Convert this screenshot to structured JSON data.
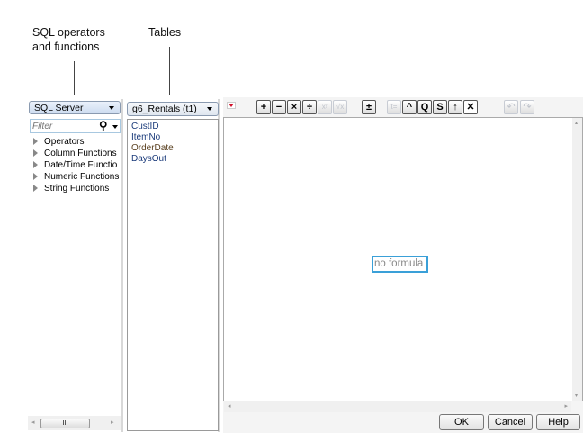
{
  "annotations": {
    "sql_label_line1": "SQL operators",
    "sql_label_line2": "and functions",
    "tables_label": "Tables"
  },
  "left_panel": {
    "dialect": "SQL Server",
    "filter_placeholder": "Filter",
    "tree": [
      {
        "label": "Operators"
      },
      {
        "label": "Column Functions"
      },
      {
        "label": "Date/Time Functio"
      },
      {
        "label": "Numeric Functions"
      },
      {
        "label": "String Functions"
      }
    ],
    "hscroll_thumb": "III"
  },
  "tables_panel": {
    "table": "g6_Rentals (t1)",
    "columns": [
      "CustID",
      "ItemNo",
      "OrderDate",
      "DaysOut"
    ]
  },
  "toolbar": {
    "buttons": [
      {
        "name": "add",
        "glyph": "+",
        "enabled": true
      },
      {
        "name": "subtract",
        "glyph": "−",
        "enabled": true
      },
      {
        "name": "multiply",
        "glyph": "×",
        "enabled": true
      },
      {
        "name": "divide",
        "glyph": "÷",
        "enabled": true
      },
      {
        "name": "power",
        "glyph": "xʸ",
        "enabled": false
      },
      {
        "name": "root",
        "glyph": "√x",
        "enabled": false
      },
      {
        "name": "negate",
        "glyph": "±",
        "enabled": true
      },
      {
        "name": "list",
        "glyph": "t=",
        "enabled": false
      },
      {
        "name": "raise",
        "glyph": "^",
        "enabled": true
      },
      {
        "name": "peel",
        "glyph": "Q",
        "enabled": true
      },
      {
        "name": "swap",
        "glyph": "S",
        "enabled": true
      },
      {
        "name": "unthrow",
        "glyph": "↑",
        "enabled": true
      },
      {
        "name": "delete",
        "glyph": "✕",
        "enabled": true
      },
      {
        "name": "undo",
        "glyph": "↶",
        "enabled": false
      },
      {
        "name": "redo",
        "glyph": "↷",
        "enabled": false
      }
    ]
  },
  "editor": {
    "placeholder": "no formula"
  },
  "buttons": {
    "ok": "OK",
    "cancel": "Cancel",
    "help": "Help"
  },
  "colors": {
    "accent": "#3aa0d8",
    "disabled": "#c0c4cc",
    "dropdown_red": "#d0102a"
  }
}
